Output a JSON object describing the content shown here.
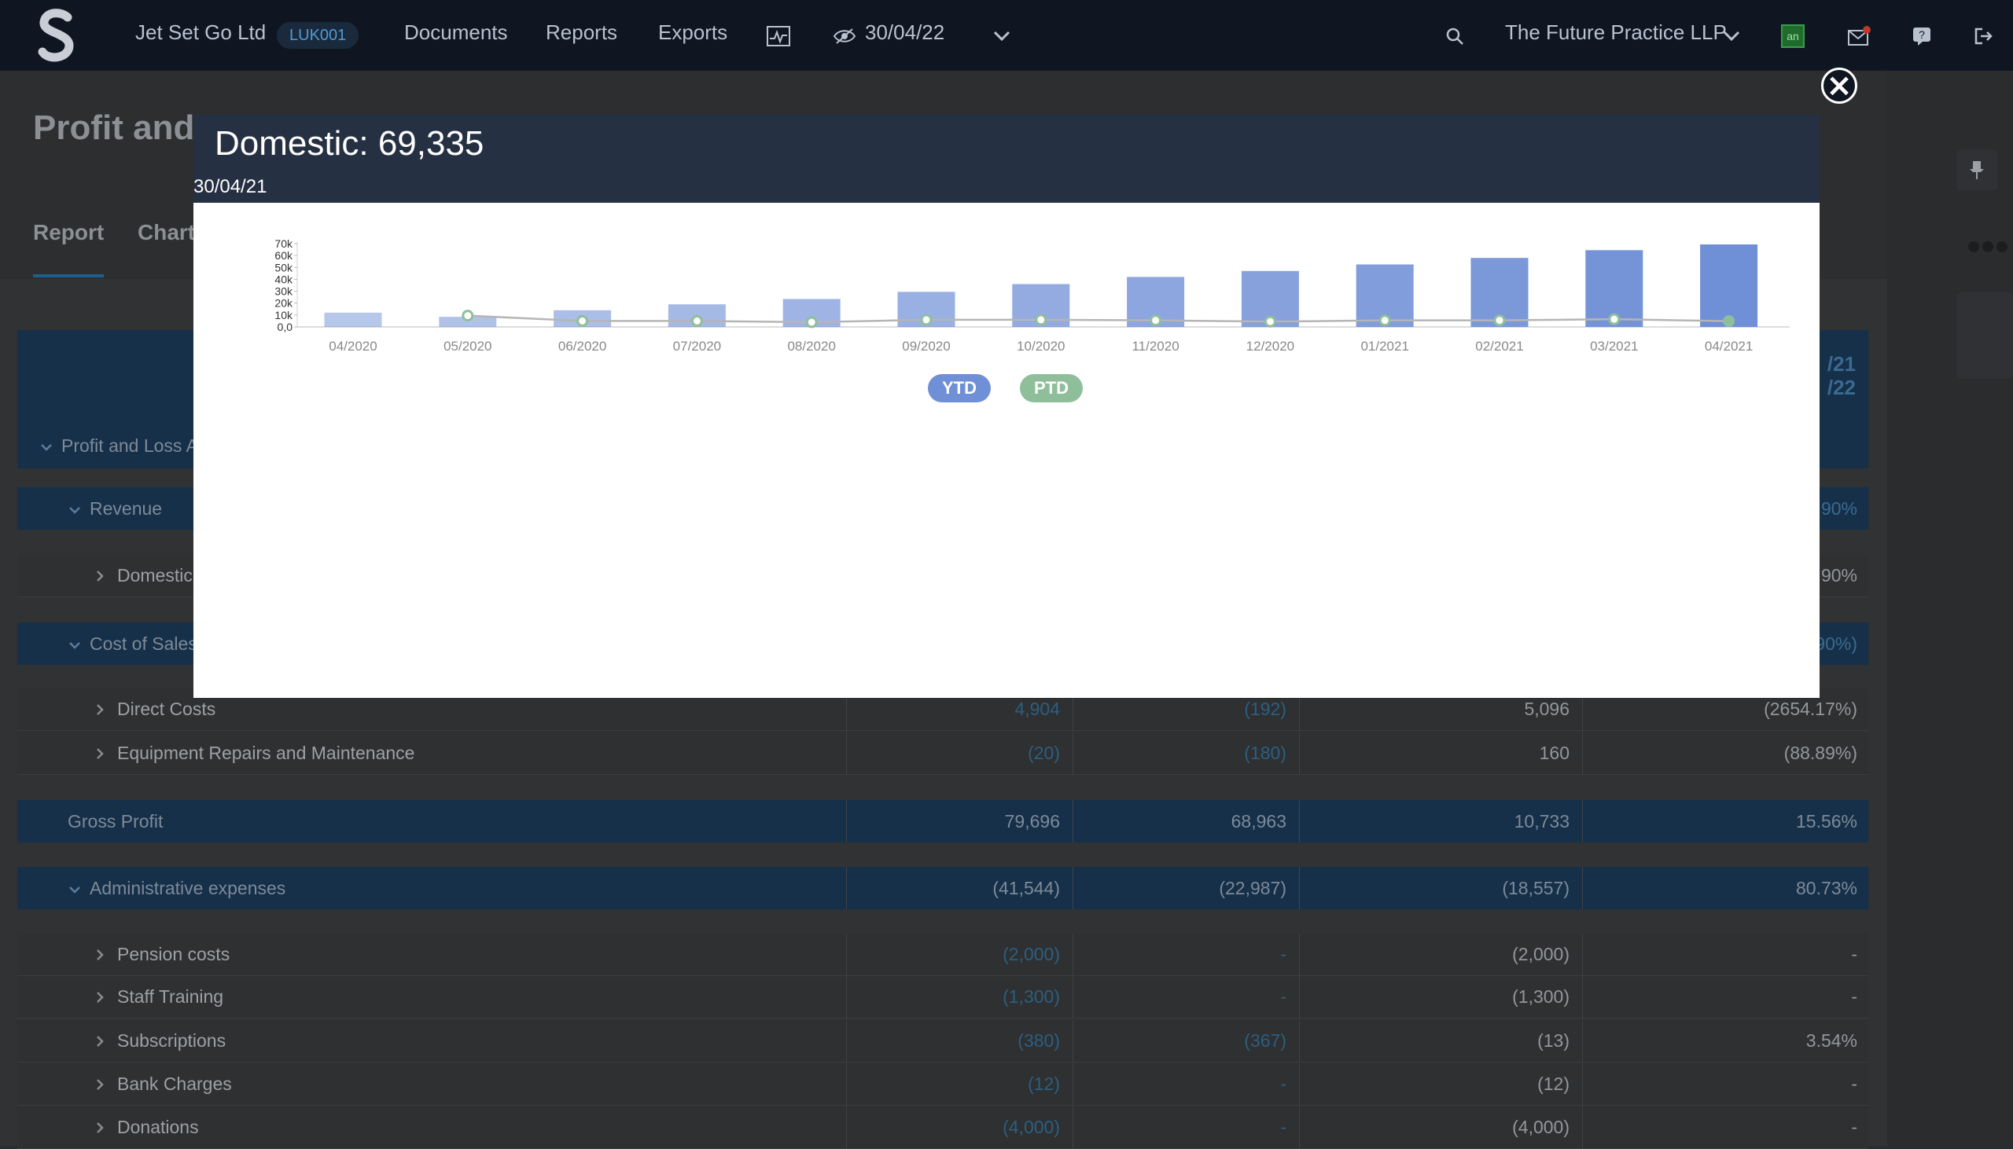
{
  "topbar": {
    "company": "Jet Set Go Ltd",
    "code": "LUK001",
    "nav": [
      "Documents",
      "Reports",
      "Exports"
    ],
    "date": "30/04/22",
    "practice": "The Future Practice LLP",
    "user_initials": "an"
  },
  "page": {
    "title": "Profit and",
    "tabs": [
      "Report",
      "Chart"
    ],
    "header_right_1": "/21",
    "header_right_2": "/22"
  },
  "table": {
    "section": "Profit and Loss A",
    "revenue": {
      "label": "Revenue",
      "pct": "90%"
    },
    "domestic": {
      "label": "Domestic",
      "pct": "90%"
    },
    "cost_of_sales": {
      "label": "Cost of Sales",
      "pct": "90%)"
    },
    "rows": [
      {
        "label": "Direct Costs",
        "c1": "4,904",
        "c2": "(192)",
        "c3": "5,096",
        "c4": "(2654.17%)"
      },
      {
        "label": "Equipment Repairs and Maintenance",
        "c1": "(20)",
        "c2": "(180)",
        "c3": "160",
        "c4": "(88.89%)"
      }
    ],
    "gross_profit": {
      "label": "Gross Profit",
      "c1": "79,696",
      "c2": "68,963",
      "c3": "10,733",
      "c4": "15.56%"
    },
    "admin": {
      "label": "Administrative expenses",
      "c1": "(41,544)",
      "c2": "(22,987)",
      "c3": "(18,557)",
      "c4": "80.73%"
    },
    "admin_rows": [
      {
        "label": "Pension costs",
        "c1": "(2,000)",
        "c2": "-",
        "c3": "(2,000)",
        "c4": "-"
      },
      {
        "label": "Staff Training",
        "c1": "(1,300)",
        "c2": "-",
        "c3": "(1,300)",
        "c4": "-"
      },
      {
        "label": "Subscriptions",
        "c1": "(380)",
        "c2": "(367)",
        "c3": "(13)",
        "c4": "3.54%"
      },
      {
        "label": "Bank Charges",
        "c1": "(12)",
        "c2": "-",
        "c3": "(12)",
        "c4": "-"
      },
      {
        "label": "Donations",
        "c1": "(4,000)",
        "c2": "-",
        "c3": "(4,000)",
        "c4": "-"
      }
    ]
  },
  "modal": {
    "title": "Domestic: 69,335",
    "subtitle": "30/04/21",
    "close_label": "×"
  },
  "chart_data": {
    "type": "bar",
    "categories": [
      "04/2020",
      "05/2020",
      "06/2020",
      "07/2020",
      "08/2020",
      "09/2020",
      "10/2020",
      "11/2020",
      "12/2020",
      "01/2021",
      "02/2021",
      "03/2021",
      "04/2021"
    ],
    "yticks": [
      "70k",
      "60k",
      "50k",
      "40k",
      "30k",
      "20k",
      "10k",
      "0,0"
    ],
    "ylim": [
      0,
      70000
    ],
    "series": [
      {
        "name": "YTD",
        "type": "bar",
        "color": "#6f8fd6",
        "values": [
          12000,
          8500,
          14000,
          19000,
          23500,
          29500,
          36000,
          42000,
          47000,
          52500,
          58000,
          64500,
          69335
        ]
      },
      {
        "name": "PTD",
        "type": "line",
        "color": "#8fbf9a",
        "values": [
          null,
          9500,
          5000,
          5000,
          4000,
          6000,
          6000,
          5500,
          4500,
          5500,
          5500,
          6500,
          4900
        ]
      }
    ],
    "legend": [
      "YTD",
      "PTD"
    ],
    "legend_colors": [
      "#6f8fd6",
      "#8fbf9a"
    ]
  }
}
